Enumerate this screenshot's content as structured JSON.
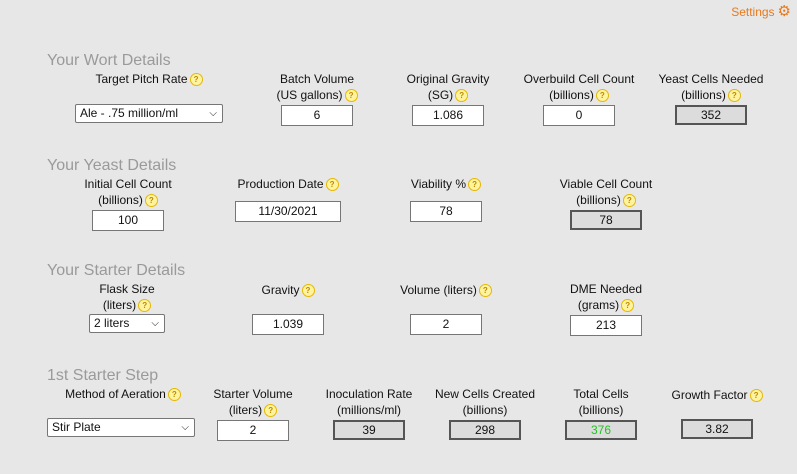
{
  "settings": {
    "label": "Settings",
    "icon": "gear-icon",
    "color": "#e8791b"
  },
  "help_icon": {
    "glyph": "?",
    "color": "#e6b800"
  },
  "wort": {
    "title": "Your Wort Details",
    "pitch_rate_label": "Target Pitch Rate",
    "pitch_rate_value": "Ale - .75 million/ml",
    "batch_volume_label1": "Batch Volume",
    "batch_volume_label2": "(US gallons)",
    "batch_volume_value": "6",
    "og_label1": "Original Gravity",
    "og_label2": "(SG)",
    "og_value": "1.086",
    "overbuild_label1": "Overbuild Cell Count",
    "overbuild_label2": "(billions)",
    "overbuild_value": "0",
    "cells_needed_label1": "Yeast Cells Needed",
    "cells_needed_label2": "(billions)",
    "cells_needed_value": "352"
  },
  "yeast": {
    "title": "Your Yeast Details",
    "initial_label1": "Initial Cell Count",
    "initial_label2": "(billions)",
    "initial_value": "100",
    "production_label": "Production Date",
    "production_value": "11/30/2021",
    "viability_label": "Viability %",
    "viability_value": "78",
    "viable_label1": "Viable Cell Count",
    "viable_label2": "(billions)",
    "viable_value": "78"
  },
  "starter": {
    "title": "Your Starter Details",
    "flask_label1": "Flask Size",
    "flask_label2": "(liters)",
    "flask_value": "2 liters",
    "gravity_label": "Gravity",
    "gravity_value": "1.039",
    "volume_label": "Volume (liters)",
    "volume_value": "2",
    "dme_label1": "DME Needed",
    "dme_label2": "(grams)",
    "dme_value": "213"
  },
  "step1": {
    "title": "1st Starter Step",
    "aeration_label": "Method of Aeration",
    "aeration_value": "Stir Plate",
    "starter_volume_label1": "Starter Volume",
    "starter_volume_label2": "(liters)",
    "starter_volume_value": "2",
    "inoculation_label1": "Inoculation Rate",
    "inoculation_label2": "(millions/ml)",
    "inoculation_value": "39",
    "new_cells_label1": "New Cells Created",
    "new_cells_label2": "(billions)",
    "new_cells_value": "298",
    "total_cells_label1": "Total Cells",
    "total_cells_label2": "(billions)",
    "total_cells_value": "376",
    "total_cells_color": "#22c322",
    "growth_label": "Growth Factor",
    "growth_value": "3.82"
  }
}
